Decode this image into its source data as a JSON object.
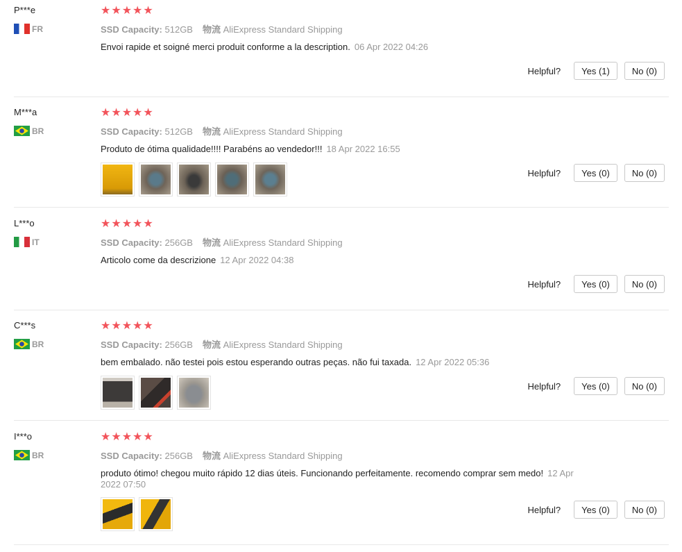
{
  "labels": {
    "sku_key": "SSD Capacity:",
    "ship_key": "物流",
    "helpful": "Helpful?"
  },
  "colors": {
    "star": "#f2545b",
    "muted": "#999999"
  },
  "reviews": [
    {
      "user": "P***e",
      "country": "FR",
      "flag": "fr",
      "stars": "★★★★★",
      "capacity": "512GB",
      "shipping": "AliExpress Standard Shipping",
      "content": "Envoi rapide et soigné merci produit conforme a la description.",
      "date": "06 Apr 2022 04:26",
      "yes": "Yes (1)",
      "no": "No (0)",
      "photos": []
    },
    {
      "user": "M***a",
      "country": "BR",
      "flag": "br",
      "stars": "★★★★★",
      "capacity": "512GB",
      "shipping": "AliExpress Standard Shipping",
      "content": "Produto de ótima qualidade!!!! Parabéns ao vendedor!!!",
      "date": "18 Apr 2022 16:55",
      "yes": "Yes (0)",
      "no": "No (0)",
      "photos": [
        "yellow-package-photo",
        "ssd-photo",
        "ssd-photo",
        "ssd-photo",
        "ssd-photo"
      ]
    },
    {
      "user": "L***o",
      "country": "IT",
      "flag": "it",
      "stars": "★★★★★",
      "capacity": "256GB",
      "shipping": "AliExpress Standard Shipping",
      "content": "Articolo come da descrizione",
      "date": "12 Apr 2022 04:38",
      "yes": "Yes (0)",
      "no": "No (0)",
      "photos": []
    },
    {
      "user": "C***s",
      "country": "BR",
      "flag": "br",
      "stars": "★★★★★",
      "capacity": "256GB",
      "shipping": "AliExpress Standard Shipping",
      "content": "bem embalado. não testei pois estou esperando outras peças. não fui taxada.",
      "date": "12 Apr 2022 05:36",
      "yes": "Yes (0)",
      "no": "No (0)",
      "photos": [
        "ssd-box-photo",
        "ssd-box-photo",
        "ssd-box-photo"
      ]
    },
    {
      "user": "I***o",
      "country": "BR",
      "flag": "br",
      "stars": "★★★★★",
      "capacity": "256GB",
      "shipping": "AliExpress Standard Shipping",
      "content": "produto ótimo! chegou muito rápido 12 dias úteis. Funcionando perfeitamente. recomendo comprar sem medo!",
      "date": "12 Apr 2022 07:50",
      "yes": "Yes (0)",
      "no": "No (0)",
      "photos": [
        "yellow-package-photo",
        "yellow-package-photo"
      ]
    }
  ]
}
